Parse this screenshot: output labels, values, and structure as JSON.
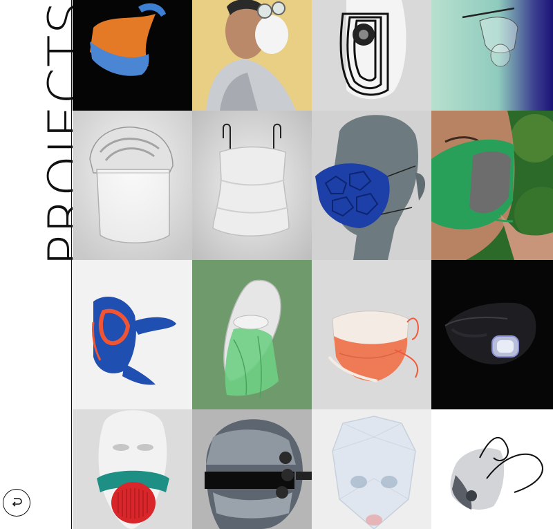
{
  "page": {
    "title": "PROJECTS"
  },
  "nav": {
    "back_icon": "return-arrow-icon"
  },
  "projects": [
    {
      "name": "knit-mask",
      "bg": "#050505"
    },
    {
      "name": "clip-on-respirator",
      "bg": "#e8cf83"
    },
    {
      "name": "concentric-line-mask",
      "bg": "#d9d9d9"
    },
    {
      "name": "glass-face-shield",
      "bg": "#9fd6c1"
    },
    {
      "name": "fingerprint-face-shield",
      "bg": "#d6d6d6"
    },
    {
      "name": "wire-neck-gaiter",
      "bg": "#cfcfcf"
    },
    {
      "name": "voronoi-lattice-mask",
      "bg": "#c9c9c9"
    },
    {
      "name": "green-fabric-mask",
      "bg": "#2f7b35"
    },
    {
      "name": "blue-orange-strap-mask",
      "bg": "#f2f2f2"
    },
    {
      "name": "leaf-visor-mask",
      "bg": "#6f9a6b"
    },
    {
      "name": "coral-cloth-mask",
      "bg": "#dadada"
    },
    {
      "name": "black-led-mask",
      "bg": "#060606"
    },
    {
      "name": "red-filter-mouthpiece",
      "bg": "#dcdcdc"
    },
    {
      "name": "chrome-band-helmet",
      "bg": "#b6b6b6"
    },
    {
      "name": "translucent-faceted-shield",
      "bg": "#eeeeee"
    },
    {
      "name": "grey-sport-mask",
      "bg": "#ffffff"
    }
  ]
}
